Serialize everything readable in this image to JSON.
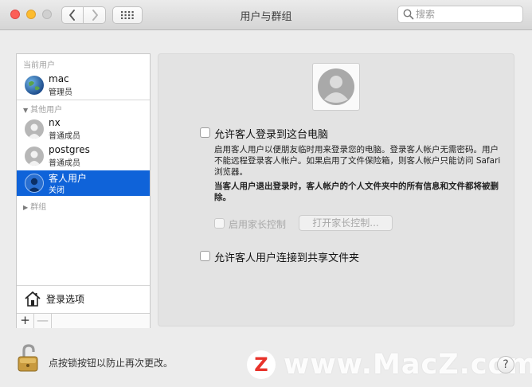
{
  "window": {
    "title": "用户与群组"
  },
  "search": {
    "placeholder": "搜索"
  },
  "sidebar": {
    "current_header": "当前用户",
    "current_user": {
      "name": "mac",
      "role": "管理员"
    },
    "other_header": "其他用户",
    "other_users": [
      {
        "name": "nx",
        "role": "普通成员"
      },
      {
        "name": "postgres",
        "role": "普通成员"
      },
      {
        "name": "客人用户",
        "role": "关闭"
      }
    ],
    "groups_header": "群组",
    "login_options": "登录选项",
    "add_label": "+",
    "remove_label": "—"
  },
  "main": {
    "allow_guest_login": "允许客人登录到这台电脑",
    "guest_desc": "启用客人用户以便朋友临时用来登录您的电脑。登录客人帐户无需密码。用户不能远程登录客人帐户。如果启用了文件保险箱，则客人帐户只能访问 Safari 浏览器。",
    "guest_logout_desc": "当客人用户退出登录时，客人帐户的个人文件夹中的所有信息和文件都将被删除。",
    "enable_parental": "启用家长控制",
    "open_parental": "打开家长控制...",
    "allow_shared_folders": "允许客人用户连接到共享文件夹"
  },
  "footer": {
    "lock_text": "点按锁按钮以防止再次更改。",
    "help_label": "?"
  },
  "watermark": {
    "logo": "Z",
    "text": "www.MacZ.com"
  },
  "icons": {
    "back": "chevron-left-icon",
    "forward": "chevron-right-icon",
    "grid": "grid-icon",
    "search": "search-icon",
    "home": "house-icon",
    "lock": "padlock-icon"
  },
  "colors": {
    "selection": "#0f63d9",
    "close": "#fc5f57",
    "minimize": "#fdbc2e"
  }
}
